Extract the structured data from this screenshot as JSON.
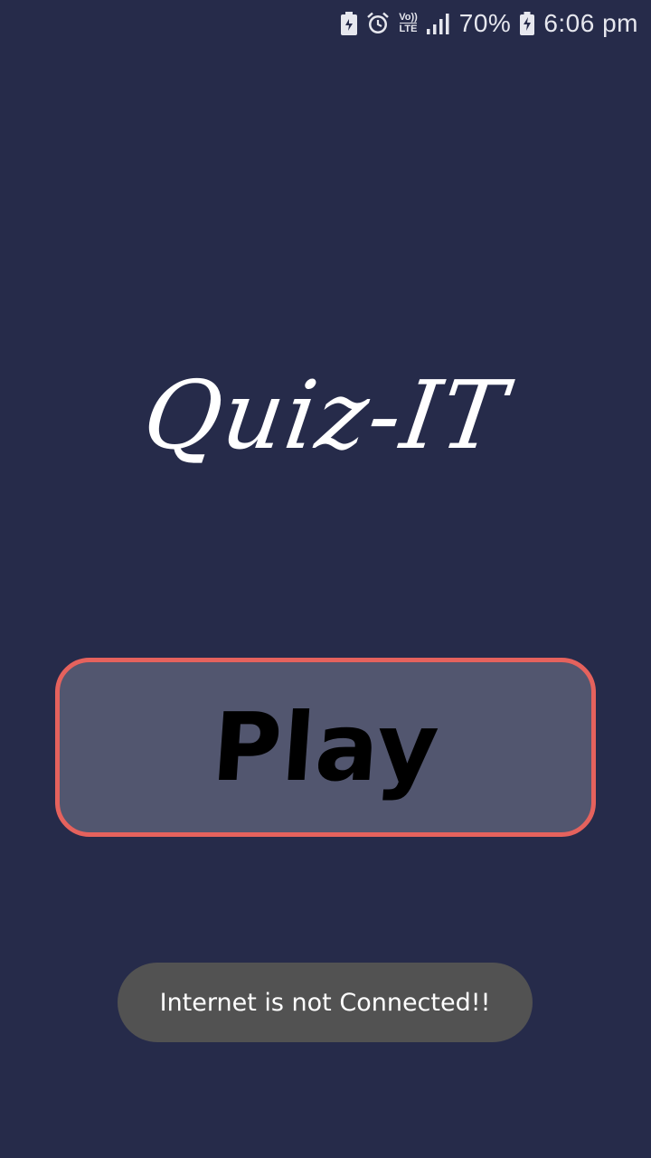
{
  "status_bar": {
    "icons": [
      "battery-saver-icon",
      "alarm-clock-icon",
      "volte-icon",
      "signal-icon",
      "battery-charging-icon"
    ],
    "volte_top": "Vo))",
    "volte_bottom": "LTE",
    "battery_percent": "70%",
    "time": "6:06 pm"
  },
  "app": {
    "title": "Quiz-IT"
  },
  "main": {
    "play_label": "Play"
  },
  "toast": {
    "message": "Internet is not Connected!!"
  },
  "colors": {
    "background": "#262b4a",
    "button_fill": "#52566f",
    "button_border": "#e5625d",
    "toast_bg": "#525252"
  }
}
